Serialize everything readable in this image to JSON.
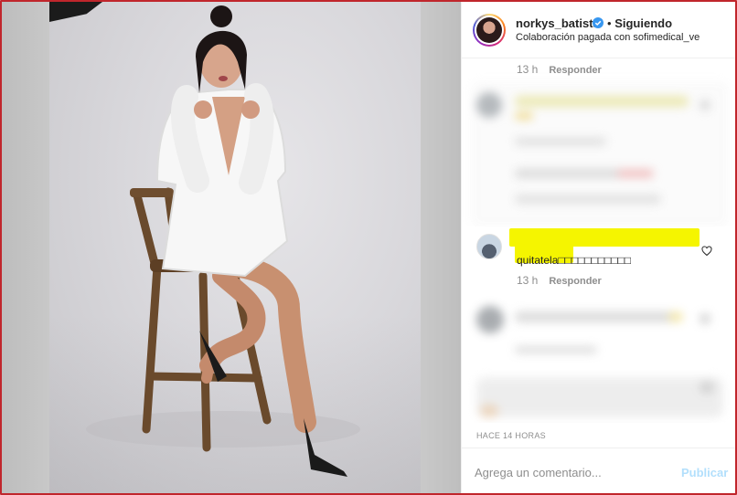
{
  "post": {
    "username": "norkys_batista",
    "separator": "•",
    "follow_status": "Siguiendo",
    "collaboration": "Colaboración pagada con sofimedical_ve",
    "verified_icon": "verified-badge-icon"
  },
  "comments": {
    "first_meta": {
      "time": "13 h",
      "reply": "Responder"
    },
    "highlighted": {
      "text": "quitatela□□□□□□□□□□□"
    },
    "second_meta": {
      "time": "13 h",
      "reply": "Responder"
    }
  },
  "timestamp": "HACE 14 HORAS",
  "composer": {
    "placeholder": "Agrega un comentario...",
    "publish_label": "Publicar"
  },
  "colors": {
    "frame_border": "#c0262c",
    "highlight": "#f5f500",
    "publish_disabled": "#b2dffc",
    "verified": "#3897f0"
  }
}
